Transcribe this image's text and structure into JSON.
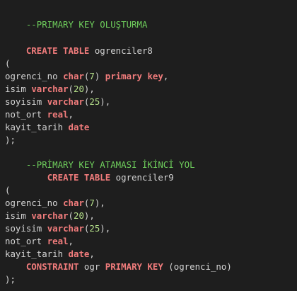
{
  "lines": [
    {
      "tokens": [
        {
          "t": "    --PRIMARY KEY OLUŞTURMA",
          "c": "cmt"
        }
      ]
    },
    {
      "tokens": [
        {
          "t": "    ",
          "c": "id"
        },
        {
          "t": "CREATE TABLE",
          "c": "kw"
        },
        {
          "t": " ogrenciler8",
          "c": "id"
        }
      ]
    },
    {
      "tokens": [
        {
          "t": "(",
          "c": "pn"
        }
      ]
    },
    {
      "tokens": [
        {
          "t": "ogrenci_no ",
          "c": "id"
        },
        {
          "t": "char",
          "c": "kw"
        },
        {
          "t": "(",
          "c": "pn"
        },
        {
          "t": "7",
          "c": "num"
        },
        {
          "t": ") ",
          "c": "pn"
        },
        {
          "t": "primary key",
          "c": "kw"
        },
        {
          "t": ",",
          "c": "pn"
        }
      ]
    },
    {
      "tokens": [
        {
          "t": "isim ",
          "c": "id"
        },
        {
          "t": "varchar",
          "c": "kw"
        },
        {
          "t": "(",
          "c": "pn"
        },
        {
          "t": "20",
          "c": "num"
        },
        {
          "t": "),",
          "c": "pn"
        }
      ]
    },
    {
      "tokens": [
        {
          "t": "soyisim ",
          "c": "id"
        },
        {
          "t": "varchar",
          "c": "kw"
        },
        {
          "t": "(",
          "c": "pn"
        },
        {
          "t": "25",
          "c": "num"
        },
        {
          "t": "),",
          "c": "pn"
        }
      ]
    },
    {
      "tokens": [
        {
          "t": "not_ort ",
          "c": "id"
        },
        {
          "t": "real",
          "c": "kw"
        },
        {
          "t": ",",
          "c": "pn"
        }
      ]
    },
    {
      "tokens": [
        {
          "t": "kayit_tarih ",
          "c": "id"
        },
        {
          "t": "date",
          "c": "kw"
        }
      ]
    },
    {
      "tokens": [
        {
          "t": ");",
          "c": "pn"
        }
      ]
    },
    {
      "tokens": [
        {
          "t": "    --PRİMARY KEY ATAMASI İKİNCİ YOL",
          "c": "cmt"
        }
      ]
    },
    {
      "tokens": [
        {
          "t": "        ",
          "c": "id"
        },
        {
          "t": "CREATE TABLE",
          "c": "kw"
        },
        {
          "t": " ogrenciler9",
          "c": "id"
        }
      ]
    },
    {
      "tokens": [
        {
          "t": "(",
          "c": "pn"
        }
      ]
    },
    {
      "tokens": [
        {
          "t": "ogrenci_no ",
          "c": "id"
        },
        {
          "t": "char",
          "c": "kw"
        },
        {
          "t": "(",
          "c": "pn"
        },
        {
          "t": "7",
          "c": "num"
        },
        {
          "t": "),",
          "c": "pn"
        }
      ]
    },
    {
      "tokens": [
        {
          "t": "isim ",
          "c": "id"
        },
        {
          "t": "varchar",
          "c": "kw"
        },
        {
          "t": "(",
          "c": "pn"
        },
        {
          "t": "20",
          "c": "num"
        },
        {
          "t": "),",
          "c": "pn"
        }
      ]
    },
    {
      "tokens": [
        {
          "t": "soyisim ",
          "c": "id"
        },
        {
          "t": "varchar",
          "c": "kw"
        },
        {
          "t": "(",
          "c": "pn"
        },
        {
          "t": "25",
          "c": "num"
        },
        {
          "t": "),",
          "c": "pn"
        }
      ]
    },
    {
      "tokens": [
        {
          "t": "not_ort ",
          "c": "id"
        },
        {
          "t": "real",
          "c": "kw"
        },
        {
          "t": ",",
          "c": "pn"
        }
      ]
    },
    {
      "tokens": [
        {
          "t": "kayit_tarih ",
          "c": "id"
        },
        {
          "t": "date",
          "c": "kw"
        },
        {
          "t": ",",
          "c": "pn"
        }
      ]
    },
    {
      "tokens": [
        {
          "t": "    ",
          "c": "id"
        },
        {
          "t": "CONSTRAINT",
          "c": "kw"
        },
        {
          "t": " ogr ",
          "c": "id"
        },
        {
          "t": "PRIMARY KEY",
          "c": "kw"
        },
        {
          "t": " (ogrenci_no)",
          "c": "id"
        }
      ]
    },
    {
      "tokens": [
        {
          "t": ");",
          "c": "pn"
        }
      ]
    }
  ]
}
